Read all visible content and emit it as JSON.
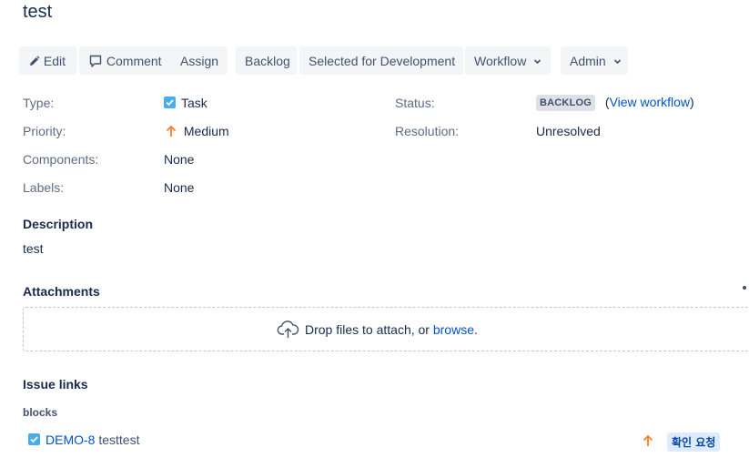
{
  "issue": {
    "title": "test"
  },
  "toolbar": {
    "edit_label": "Edit",
    "comment_label": "Comment",
    "assign_label": "Assign",
    "backlog_label": "Backlog",
    "selected_label": "Selected for Development",
    "workflow_label": "Workflow",
    "admin_label": "Admin"
  },
  "details": {
    "type_label": "Type:",
    "type_value": "Task",
    "priority_label": "Priority:",
    "priority_value": "Medium",
    "components_label": "Components:",
    "components_value": "None",
    "labels_label": "Labels:",
    "labels_value": "None",
    "status_label": "Status:",
    "status_value": "BACKLOG",
    "view_workflow_open": "(",
    "view_workflow_link": "View workflow",
    "view_workflow_close": ")",
    "resolution_label": "Resolution:",
    "resolution_value": "Unresolved"
  },
  "description": {
    "heading": "Description",
    "text": "test"
  },
  "attachments": {
    "heading": "Attachments",
    "drop_text": "Drop files to attach, or ",
    "browse_link": "browse",
    "period": "."
  },
  "issue_links": {
    "heading": "Issue links",
    "relation": "blocks",
    "items": [
      {
        "key": "DEMO-8",
        "summary": "testtest",
        "status": "확인 요청"
      }
    ]
  },
  "colors": {
    "task_icon": "#4bade8",
    "priority_medium": "#ff7f27",
    "link": "#0052cc",
    "status_lozenge_bg": "#dfe1e6",
    "status_in_review_bg": "#deebff"
  },
  "icons": {
    "edit": "pencil-icon",
    "comment": "speech-bubble-icon",
    "chevron": "chevron-down-icon",
    "task": "checkbox-task-icon",
    "priority": "arrow-up-icon",
    "upload": "cloud-upload-icon"
  }
}
